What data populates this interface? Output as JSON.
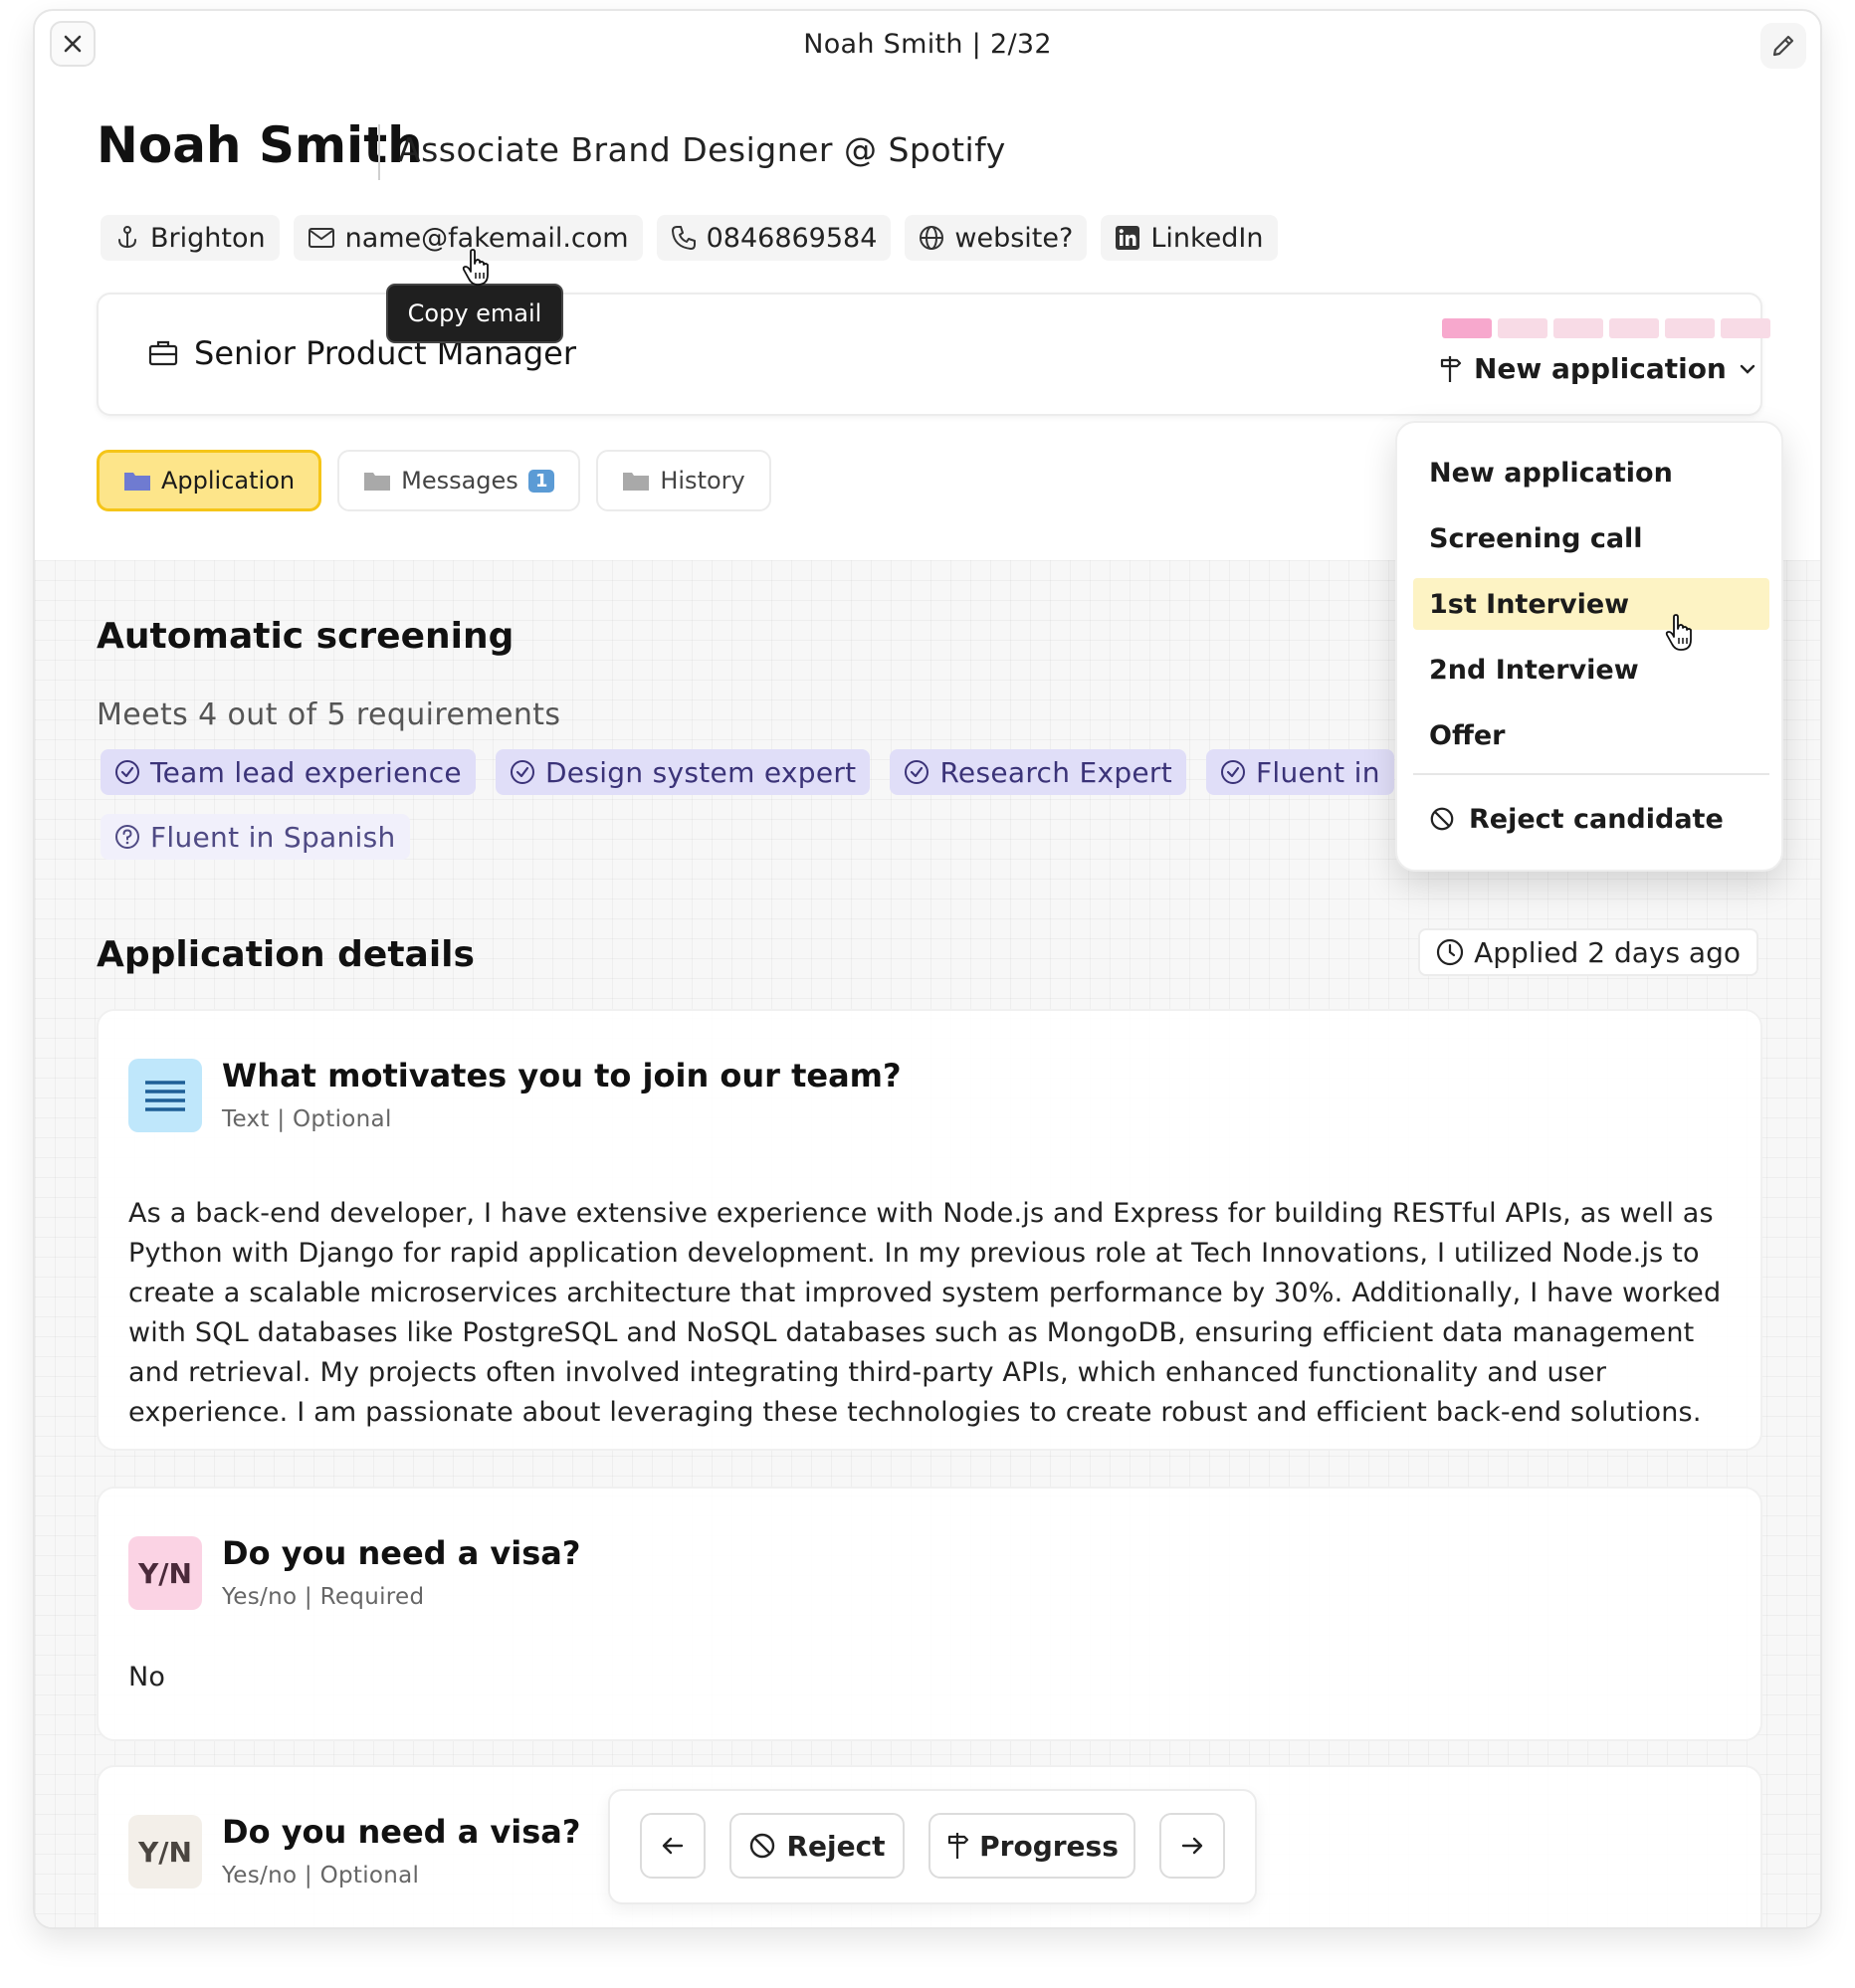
{
  "window": {
    "title": "Noah Smith | 2/32"
  },
  "candidate": {
    "name": "Noah Smith",
    "role": "Associate Brand Designer @ Spotify",
    "contacts": [
      {
        "icon": "anchor-icon",
        "label": "Brighton"
      },
      {
        "icon": "mail-icon",
        "label": "name@fakemail.com"
      },
      {
        "icon": "phone-icon",
        "label": "0846869584"
      },
      {
        "icon": "globe-icon",
        "label": "website?"
      },
      {
        "icon": "linkedin-icon",
        "label": "LinkedIn"
      }
    ]
  },
  "tooltip": {
    "text": "Copy email"
  },
  "job": {
    "title": "Senior Product Manager",
    "stage_label": "New application",
    "stage_progress": {
      "completed": 1,
      "total": 6
    },
    "colors": {
      "done": "#f7a8cd",
      "todo": "#f8dbe6"
    }
  },
  "tabs": [
    {
      "label": "Application",
      "active": true
    },
    {
      "label": "Messages",
      "badge": "1"
    },
    {
      "label": "History"
    }
  ],
  "screening": {
    "heading": "Automatic screening",
    "summary": "Meets 4 out of 5 requirements",
    "requirements": [
      {
        "label": "Team lead experience",
        "status": "met"
      },
      {
        "label": "Design system expert",
        "status": "met"
      },
      {
        "label": "Research Expert",
        "status": "met"
      },
      {
        "label": "Fluent in",
        "status": "met"
      },
      {
        "label": "Fluent in Spanish",
        "status": "unknown"
      }
    ]
  },
  "details": {
    "heading": "Application details",
    "applied": "Applied 2 days ago",
    "questions": [
      {
        "icon": "text-lines-icon",
        "icon_color": "#bfe7fb",
        "title": "What motivates you to join our team?",
        "meta": "Text | Optional",
        "answer": "As a back-end developer, I have extensive experience with Node.js and Express for building RESTful APIs, as well as Python with Django for rapid application development. In my previous role at Tech Innovations, I utilized Node.js to create a scalable microservices architecture that improved system performance by 30%. Additionally, I have worked with SQL databases like PostgreSQL and NoSQL databases such as MongoDB, ensuring efficient data management and retrieval. My projects often involved integrating third-party APIs, which enhanced functionality and user experience. I am passionate about leveraging these technologies to create robust and efficient back-end solutions."
      },
      {
        "icon_text": "Y/N",
        "icon_color": "#fbd3e4",
        "title": "Do you need a visa?",
        "meta": "Yes/no | Required",
        "answer": "No"
      },
      {
        "icon_text": "Y/N",
        "icon_color": "#f3efe9",
        "title": "Do you need a visa?",
        "meta": "Yes/no | Optional"
      }
    ]
  },
  "actions": {
    "reject": "Reject",
    "progress": "Progress"
  },
  "stage_menu": {
    "items": [
      "New application",
      "Screening call",
      "1st Interview",
      "2nd Interview",
      "Offer"
    ],
    "hovered": "1st Interview",
    "reject": "Reject candidate"
  },
  "colors": {
    "accent_yellow": "#fde58a",
    "requirement_bg": "#e0def8",
    "menu_hover": "#fdf3c4"
  }
}
